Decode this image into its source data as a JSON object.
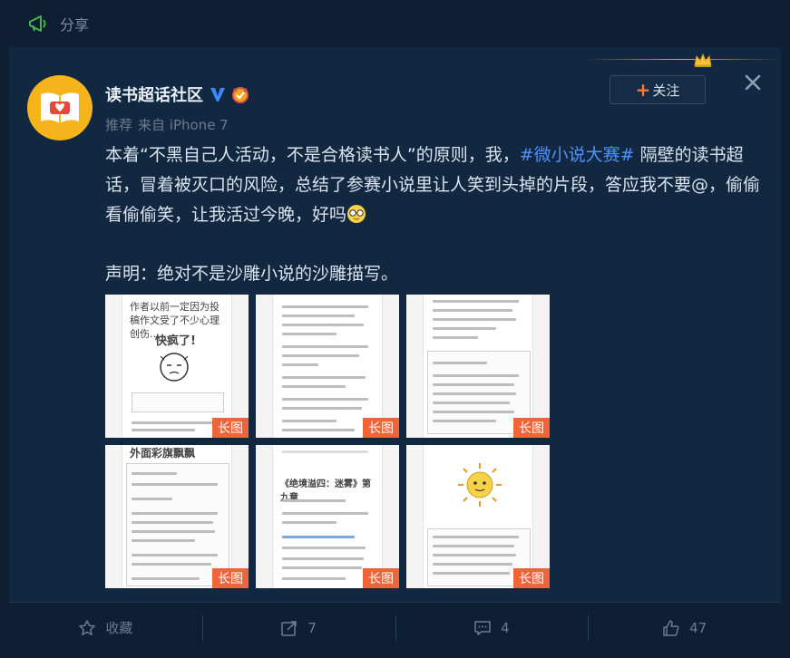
{
  "topbar": {
    "share_label": "分享"
  },
  "user": {
    "name": "读书超话社区",
    "meta_recommend": "推荐",
    "meta_source": "来自 iPhone 7"
  },
  "follow": {
    "plus": "+",
    "label": "关注"
  },
  "post": {
    "text_before_tag": "本着“不黑自己人活动，不是合格读书人”的原则，我，",
    "hashtag": "#微小说大赛#",
    "text_after_tag": " 隔壁的读书超话，冒着被灭口的风险，总结了参赛小说里让人笑到头掉的片段，答应我不要@，偷偷看偷偷笑，让我活过今晚，好吗",
    "statement": "声明：绝对不是沙雕小说的沙雕描写。"
  },
  "thumbnails": [
    {
      "label": "长图",
      "caption": "作者以前一定因为投稿作文受了不少心理创伤……",
      "art": "快疯了!"
    },
    {
      "label": "长图"
    },
    {
      "label": "长图"
    },
    {
      "label": "长图",
      "caption": "外面彩旗飘飘"
    },
    {
      "label": "长图",
      "caption": "《绝境溢四：迷雾》第九章"
    },
    {
      "label": "长图"
    }
  ],
  "actions": {
    "favorite": "收藏",
    "repost_count": "7",
    "comment_count": "4",
    "like_count": "47"
  },
  "colors": {
    "background": "#0f1f33",
    "card": "#112840",
    "hashtag": "#4d93ff",
    "long_label": "#f0643a",
    "plus": "#ff7a2e",
    "avatar": "#f5b41c"
  }
}
